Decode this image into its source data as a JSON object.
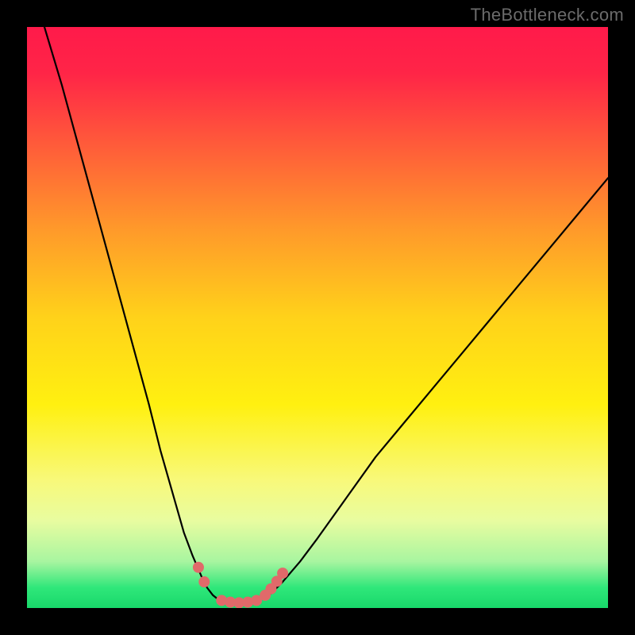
{
  "watermark": "TheBottleneck.com",
  "chart_data": {
    "type": "line",
    "title": "",
    "xlabel": "",
    "ylabel": "",
    "xlim": [
      0,
      100
    ],
    "ylim": [
      0,
      100
    ],
    "background_gradient": {
      "stops": [
        {
          "offset": 0.0,
          "color": "#ff1a4a"
        },
        {
          "offset": 0.08,
          "color": "#ff2547"
        },
        {
          "offset": 0.2,
          "color": "#ff5a3a"
        },
        {
          "offset": 0.35,
          "color": "#ff9a2a"
        },
        {
          "offset": 0.5,
          "color": "#ffd21a"
        },
        {
          "offset": 0.65,
          "color": "#fff010"
        },
        {
          "offset": 0.78,
          "color": "#f8f97a"
        },
        {
          "offset": 0.85,
          "color": "#e8fca0"
        },
        {
          "offset": 0.92,
          "color": "#a8f5a0"
        },
        {
          "offset": 0.965,
          "color": "#2fe77a"
        },
        {
          "offset": 1.0,
          "color": "#18d86a"
        }
      ]
    },
    "series": [
      {
        "name": "left-branch",
        "x": [
          3,
          6,
          9,
          12,
          15,
          18,
          21,
          23,
          25,
          27,
          28.5,
          30,
          31,
          32,
          33
        ],
        "y": [
          100,
          90,
          79,
          68,
          57,
          46,
          35,
          27,
          20,
          13,
          9,
          5.5,
          3.5,
          2.2,
          1.4
        ]
      },
      {
        "name": "right-branch",
        "x": [
          40,
          42,
          44,
          47,
          50,
          55,
          60,
          65,
          70,
          75,
          80,
          85,
          90,
          95,
          100
        ],
        "y": [
          1.4,
          2.5,
          4.5,
          8,
          12,
          19,
          26,
          32,
          38,
          44,
          50,
          56,
          62,
          68,
          74
        ]
      },
      {
        "name": "valley-floor",
        "x": [
          33,
          34.5,
          36,
          37.5,
          39,
          40
        ],
        "y": [
          1.4,
          1.0,
          0.9,
          0.9,
          1.0,
          1.4
        ]
      }
    ],
    "markers": {
      "name": "highlight-dots",
      "color": "#e06a6a",
      "points": [
        {
          "x": 29.5,
          "y": 7.0
        },
        {
          "x": 30.5,
          "y": 4.5
        },
        {
          "x": 33.5,
          "y": 1.3
        },
        {
          "x": 35.0,
          "y": 1.0
        },
        {
          "x": 36.5,
          "y": 0.9
        },
        {
          "x": 38.0,
          "y": 1.0
        },
        {
          "x": 39.5,
          "y": 1.3
        },
        {
          "x": 41.0,
          "y": 2.2
        },
        {
          "x": 42.0,
          "y": 3.3
        },
        {
          "x": 43.0,
          "y": 4.6
        },
        {
          "x": 44.0,
          "y": 6.0
        }
      ]
    }
  }
}
